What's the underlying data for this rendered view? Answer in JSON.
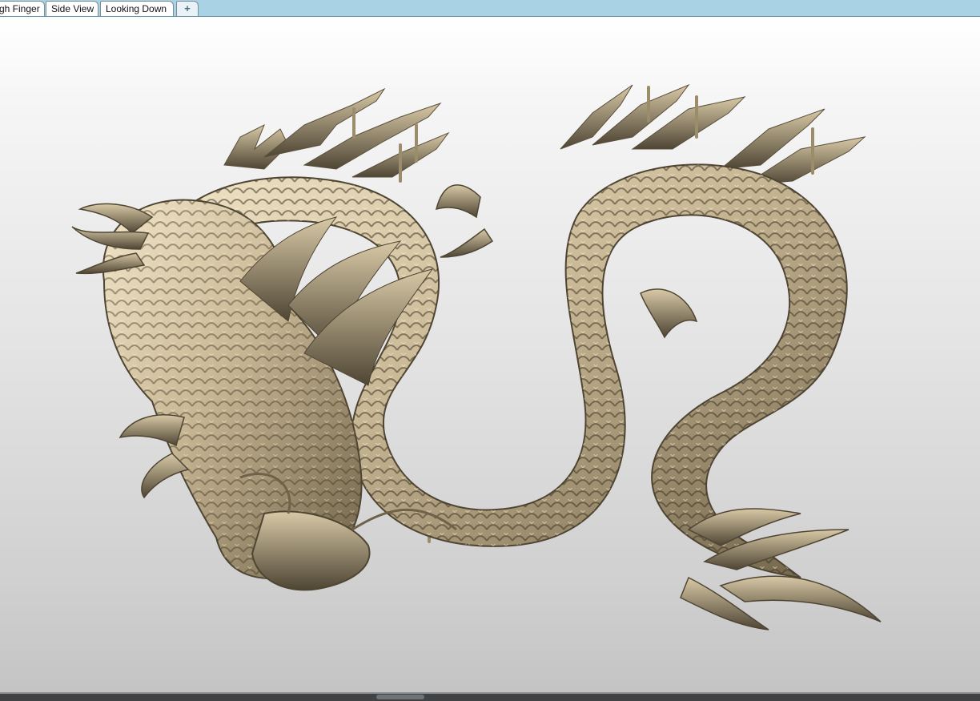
{
  "tabs": [
    {
      "label": "gh Finger"
    },
    {
      "label": "Side View"
    },
    {
      "label": "Looking Down"
    }
  ],
  "add_tab_symbol": "+",
  "viewport": {
    "model": "dragon-relief",
    "material_color": "#c9b895",
    "background_top": "#ffffff",
    "background_bottom": "#c4c4c4"
  }
}
